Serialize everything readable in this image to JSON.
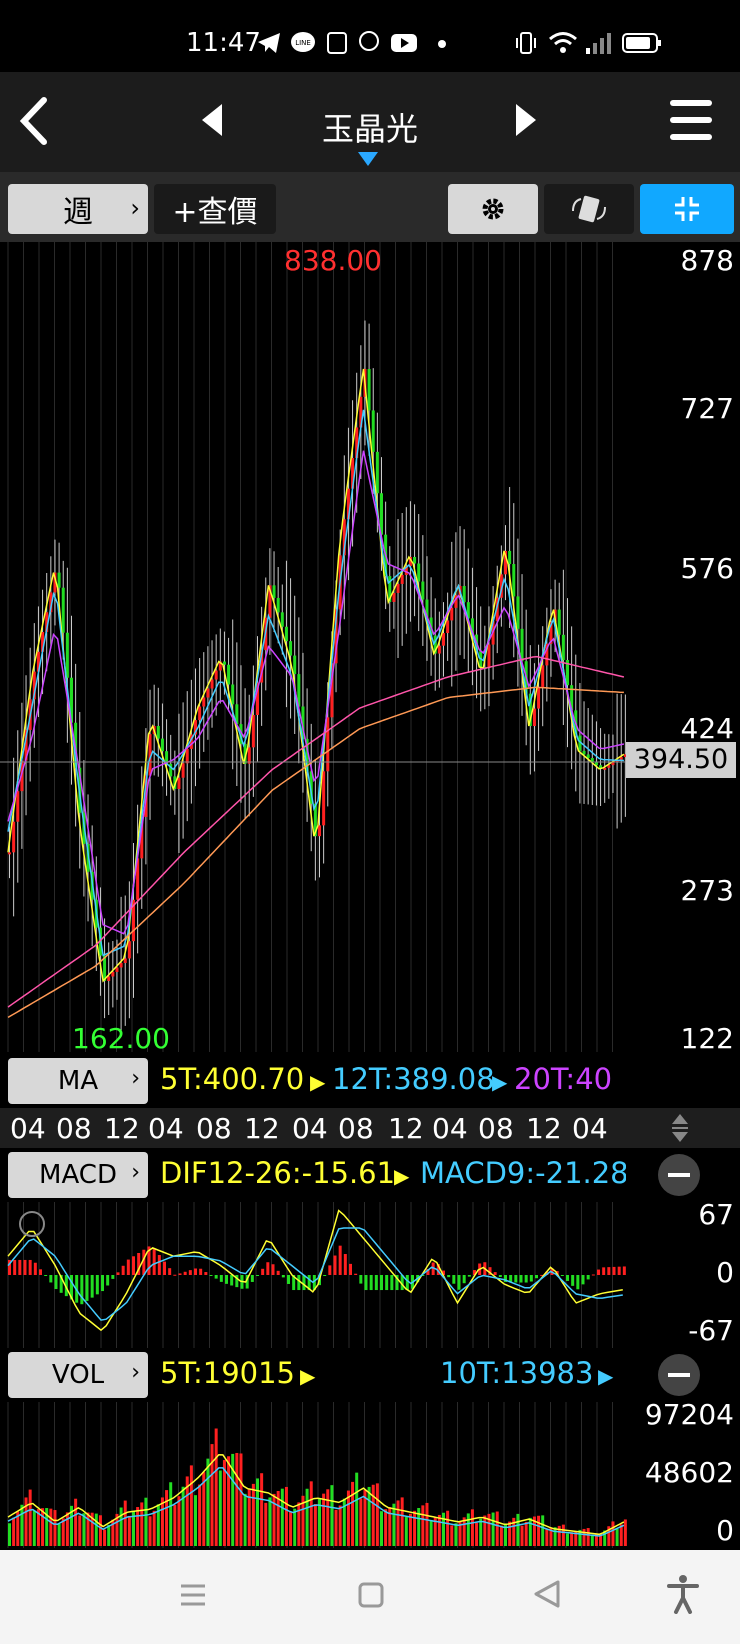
{
  "status_bar": {
    "time": "11:47",
    "icons": [
      "telegram-icon",
      "line-icon",
      "app-icon",
      "gomaji-icon",
      "youtube-icon",
      "dot-icon",
      "vibrate-icon",
      "wifi-icon",
      "signal-icon",
      "battery-icon"
    ]
  },
  "nav": {
    "title": "玉晶光",
    "back_icon": "back-chevron-icon",
    "prev_icon": "prev-triangle-icon",
    "next_icon": "next-triangle-icon",
    "menu_icon": "hamburger-icon"
  },
  "toolbar": {
    "period_label": "週",
    "quote_label": "+查價",
    "settings_icon": "gear-icon",
    "rotate_icon": "rotate-icon",
    "collapse_icon": "collapse-icon"
  },
  "price_chart": {
    "high_label": "838.00",
    "low_label": "162.00",
    "current_label": "394.50",
    "axis_labels": [
      "878",
      "727",
      "576",
      "424",
      "273",
      "122"
    ]
  },
  "ma_row": {
    "button": "MA",
    "values": [
      "5T:400.70",
      "12T:389.08",
      "20T:40"
    ]
  },
  "time_axis": [
    "04",
    "08",
    "12",
    "04",
    "08",
    "12",
    "04",
    "08",
    "12",
    "04",
    "08",
    "12",
    "04"
  ],
  "macd_row": {
    "button": "MACD",
    "values": [
      "DIF12-26:-15.61",
      "MACD9:-21.28"
    ],
    "axis_labels": [
      "67",
      "0",
      "-67"
    ]
  },
  "vol_row": {
    "button": "VOL",
    "values": [
      "5T:19015",
      "10T:13983"
    ],
    "axis_labels": [
      "97204",
      "48602",
      "0"
    ]
  },
  "colors": {
    "up": "#ff2020",
    "down": "#22dd22",
    "ma5": "#ffff33",
    "ma12": "#44ccff",
    "ma20": "#cc44ff",
    "high_text": "#ff3030",
    "low_text": "#33ff33",
    "accent": "#00a8ff"
  },
  "chart_data": [
    {
      "type": "line",
      "series": [
        {
          "name": "5T",
          "values": [
            300,
            470,
            580,
            330,
            175,
            200,
            430,
            360,
            440,
            490,
            380,
            560,
            480,
            300,
            600,
            770,
            540,
            590,
            490,
            560,
            470,
            600,
            420,
            540,
            400,
            380,
            395
          ]
        },
        {
          "name": "12T",
          "values": [
            320,
            440,
            560,
            360,
            200,
            210,
            400,
            380,
            420,
            470,
            400,
            530,
            470,
            330,
            560,
            730,
            560,
            580,
            500,
            560,
            480,
            570,
            440,
            530,
            410,
            390,
            389
          ]
        },
        {
          "name": "20T",
          "values": [
            330,
            410,
            520,
            380,
            230,
            220,
            380,
            390,
            410,
            450,
            410,
            500,
            470,
            360,
            520,
            690,
            580,
            570,
            510,
            550,
            490,
            540,
            460,
            510,
            420,
            400,
            405
          ]
        }
      ],
      "ylim": [
        122,
        878
      ],
      "annotations": [
        "838.00",
        "162.00",
        "394.50"
      ]
    },
    {
      "type": "line",
      "series": [
        {
          "name": "DIF12-26",
          "values": [
            20,
            50,
            10,
            -40,
            -60,
            -20,
            30,
            20,
            25,
            10,
            -10,
            40,
            0,
            -20,
            70,
            40,
            10,
            -20,
            20,
            -30,
            10,
            -10,
            -20,
            10,
            -30,
            -20,
            -15.61
          ]
        },
        {
          "name": "MACD9",
          "values": [
            10,
            40,
            20,
            -20,
            -50,
            -30,
            10,
            20,
            20,
            15,
            0,
            30,
            10,
            -10,
            50,
            50,
            20,
            -10,
            10,
            -20,
            0,
            -5,
            -15,
            5,
            -20,
            -25,
            -21.28
          ]
        }
      ],
      "ylim": [
        -67,
        67
      ]
    },
    {
      "type": "bar",
      "series": [
        {
          "name": "VOL",
          "values": [
            30000,
            45000,
            25000,
            40000,
            20000,
            35000,
            38000,
            50000,
            70000,
            97204,
            60000,
            55000,
            40000,
            50000,
            45000,
            60000,
            40000,
            35000,
            30000,
            25000,
            30000,
            22000,
            28000,
            18000,
            15000,
            12000,
            25000
          ]
        },
        {
          "name": "5T",
          "values": [
            19015
          ]
        },
        {
          "name": "10T",
          "values": [
            13983
          ]
        }
      ],
      "ylim": [
        0,
        97204
      ]
    }
  ]
}
